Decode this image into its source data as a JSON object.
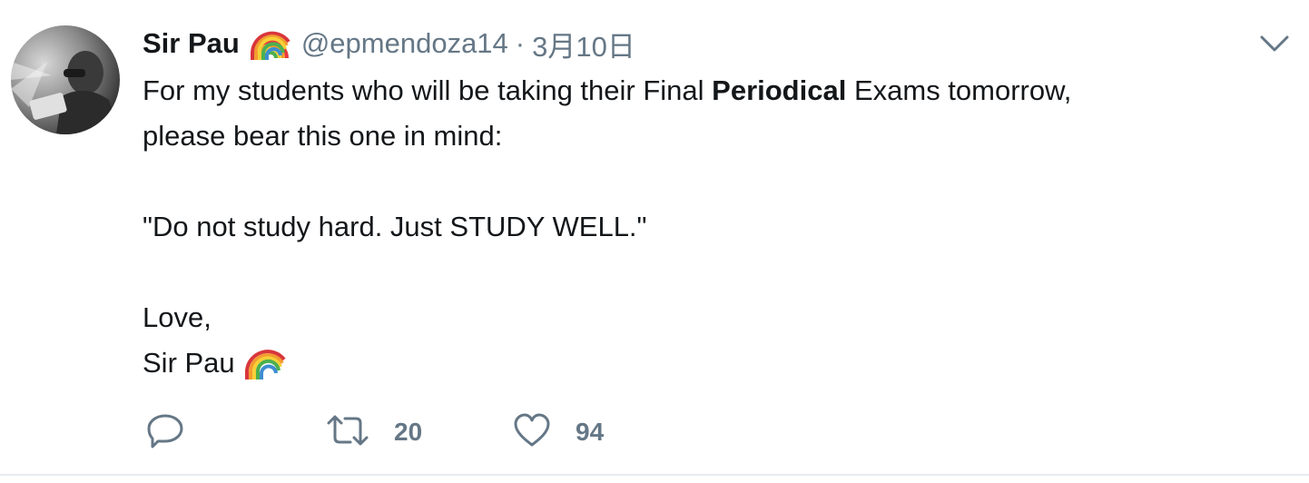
{
  "tweet": {
    "display_name": "Sir Pau",
    "handle": "@epmendoza14",
    "separator": "·",
    "timestamp": "3月10日",
    "text": {
      "line1_pre": "For my students who will be taking their Final ",
      "line1_bold": "Periodical",
      "line1_post": " Exams tomorrow,",
      "line2": "please bear this one in mind:",
      "quote": "\"Do not study hard. Just STUDY WELL.\"",
      "signoff": "Love,",
      "signature": "Sir Pau"
    }
  },
  "actions": {
    "reply_icon": "reply-icon",
    "retweet_icon": "retweet-icon",
    "retweet_count": "20",
    "like_icon": "heart-icon",
    "like_count": "94"
  },
  "colors": {
    "text": "#14171a",
    "secondary": "#657786",
    "divider": "#e6ecf0"
  }
}
